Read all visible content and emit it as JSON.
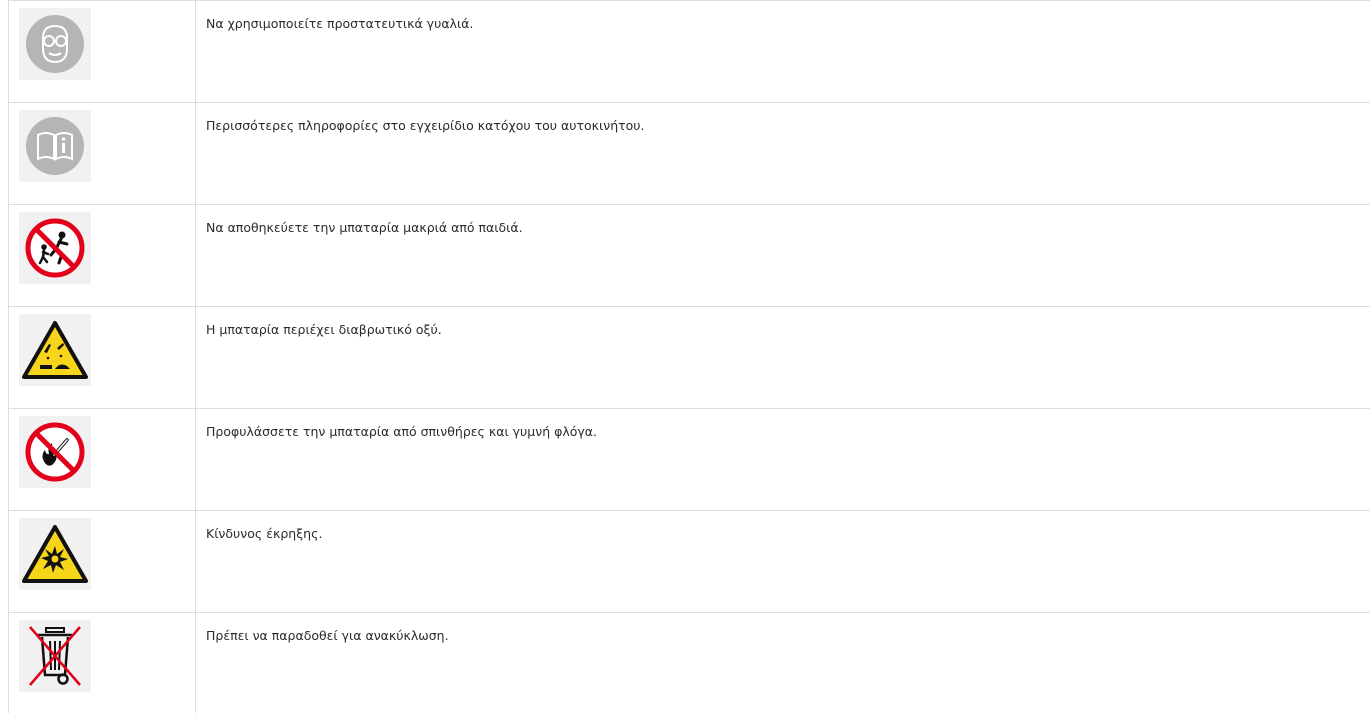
{
  "rows": [
    {
      "icon": "safety-goggles-icon",
      "text": "Να χρησιμοποιείτε προστατευτικά γυαλιά."
    },
    {
      "icon": "owner-manual-icon",
      "text": "Περισσότερες πληροφορίες στο εγχειρίδιο κατόχου του αυτοκινήτου."
    },
    {
      "icon": "keep-away-from-children-icon",
      "text": "Να αποθηκεύετε την μπαταρία μακριά από παιδιά."
    },
    {
      "icon": "corrosive-warning-icon",
      "text": "Η μπαταρία περιέχει διαβρωτικό οξύ."
    },
    {
      "icon": "no-sparks-open-flame-icon",
      "text": "Προφυλάσσετε την μπαταρία από σπινθήρες και γυμνή φλόγα."
    },
    {
      "icon": "explosion-warning-icon",
      "text": "Κίνδυνος έκρηξης."
    },
    {
      "icon": "recycle-no-bin-icon",
      "text": "Πρέπει να παραδοθεί για ανακύκλωση."
    }
  ],
  "colors": {
    "prohibition_red": "#e3001b",
    "warning_yellow": "#f7d51a",
    "mandatory_gray": "#b5b5b5"
  }
}
